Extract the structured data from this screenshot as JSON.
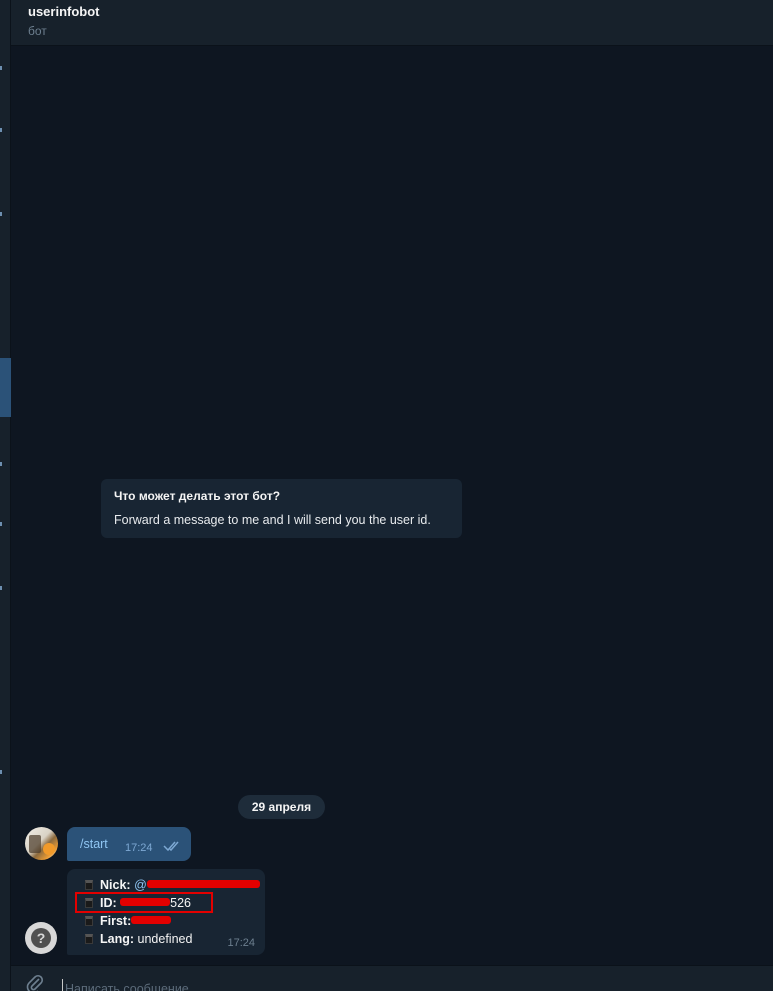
{
  "header": {
    "title": "userinfobot",
    "subtitle": "бот"
  },
  "info_card": {
    "question": "Что может делать этот бот?",
    "answer": "Forward a message to me and I will send you the user id."
  },
  "date_separator": "29 апреля",
  "outgoing_message": {
    "text": "/start",
    "time": "17:24",
    "status_icon": "double-check-icon"
  },
  "bot_reply": {
    "rows": [
      {
        "key": "Nick:",
        "value_prefix": "@",
        "value_suffix": "",
        "redacted": true
      },
      {
        "key": "ID:",
        "value_prefix": "",
        "value_suffix": "526",
        "redacted": true
      },
      {
        "key": "First:",
        "value_prefix": "",
        "value_suffix": "",
        "redacted": true
      },
      {
        "key": "Lang:",
        "value_prefix": "undefined",
        "value_suffix": "",
        "redacted": false
      }
    ],
    "time": "17:24"
  },
  "composer": {
    "placeholder": "Написать сообщение..."
  },
  "colors": {
    "background": "#0e1621",
    "panel": "#17212b",
    "outgoing_bubble": "#2b5278",
    "incoming_bubble": "#182533",
    "accent": "#8fc5f2",
    "redaction": "#e30000"
  }
}
